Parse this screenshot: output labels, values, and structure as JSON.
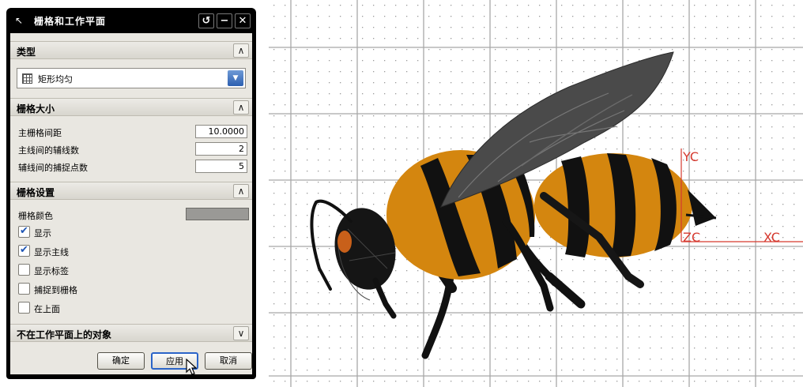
{
  "dialog": {
    "title": "栅格和工作平面",
    "icons": {
      "title": "pointer-icon",
      "reset": "reset-icon",
      "minimize": "minimize-icon",
      "close": "close-icon"
    },
    "sections": {
      "type": {
        "header": "类型",
        "selected": "矩形均匀",
        "icon": "grid-icon"
      },
      "grid_size": {
        "header": "栅格大小",
        "rows": [
          {
            "label": "主栅格间距",
            "value": "10.0000"
          },
          {
            "label": "主线间的辅线数",
            "value": "2"
          },
          {
            "label": "辅线间的捕捉点数",
            "value": "5"
          }
        ]
      },
      "grid_settings": {
        "header": "栅格设置",
        "color_label": "栅格颜色",
        "color": "#9a9996",
        "options": [
          {
            "label": "显示",
            "checked": true
          },
          {
            "label": "显示主线",
            "checked": true
          },
          {
            "label": "显示标签",
            "checked": false
          },
          {
            "label": "捕捉到栅格",
            "checked": false
          },
          {
            "label": "在上面",
            "checked": false
          }
        ]
      },
      "off_plane": {
        "header": "不在工作平面上的对象"
      }
    },
    "buttons": {
      "ok": "确定",
      "apply": "应用",
      "cancel": "取消"
    }
  },
  "viewport": {
    "axes": {
      "y": "YC",
      "z": "ZC",
      "x": "XC"
    },
    "axis_color": "#d6392f",
    "model": "bee"
  }
}
